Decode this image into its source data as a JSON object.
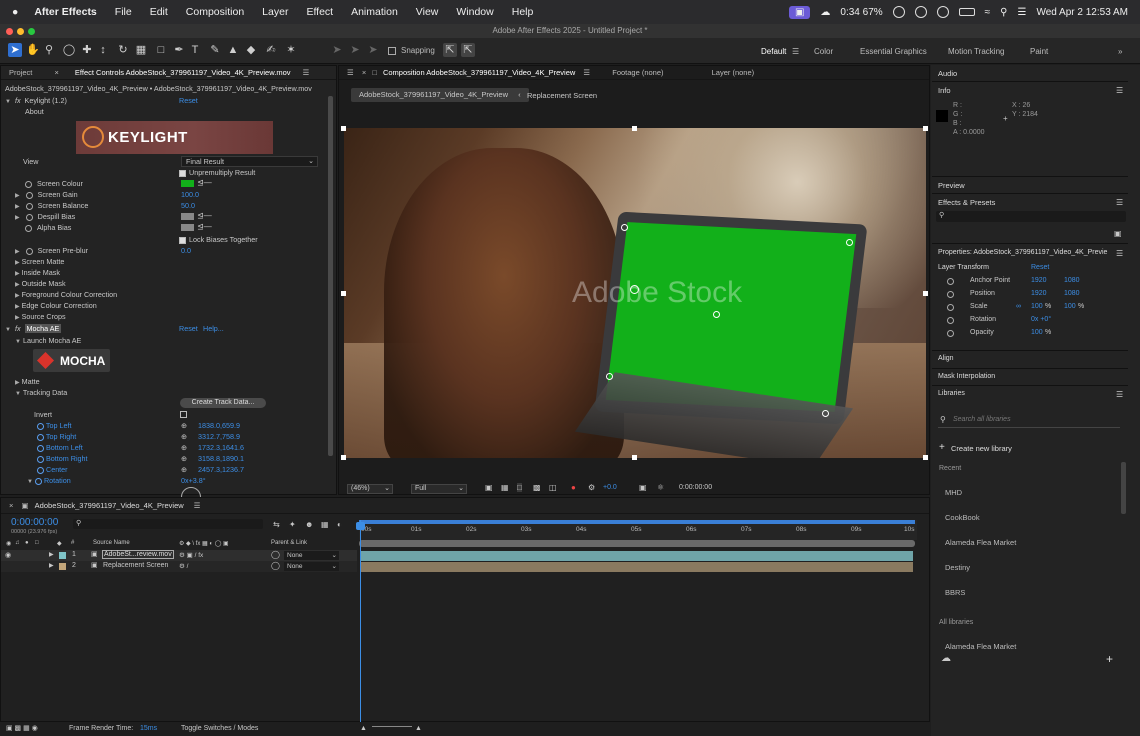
{
  "menubar": {
    "apple": "",
    "app": "After Effects",
    "items": [
      "File",
      "Edit",
      "Composition",
      "Layer",
      "Effect",
      "Animation",
      "View",
      "Window",
      "Help"
    ],
    "battery_status": "0:34 67%",
    "datetime": "Wed Apr 2  12:53 AM"
  },
  "window": {
    "title": "Adobe After Effects 2025 - Untitled Project *"
  },
  "toolbar": {
    "snapping": "Snapping",
    "workspaces": [
      "Default",
      "Color",
      "Essential Graphics",
      "Motion Tracking",
      "Paint"
    ]
  },
  "left_panel": {
    "tab_project": "Project",
    "tab_effect": "Effect Controls AdobeStock_379961197_Video_4K_Preview.mov",
    "breadcrumb": "AdobeStock_379961197_Video_4K_Preview • AdobeStock_379961197_Video_4K_Preview.mov",
    "keylight": {
      "name": "Keylight (1.2)",
      "reset": "Reset",
      "about": "About",
      "logo": "KEYLIGHT",
      "view_label": "View",
      "view_value": "Final Result",
      "unpremultiply": "Unpremultiply Result",
      "screen_colour": "Screen Colour",
      "screen_gain": "Screen Gain",
      "screen_gain_val": "100.0",
      "screen_balance": "Screen Balance",
      "screen_balance_val": "50.0",
      "despill_bias": "Despill Bias",
      "alpha_bias": "Alpha Bias",
      "lock_biases": "Lock Biases Together",
      "screen_preblur": "Screen Pre-blur",
      "screen_preblur_val": "0.0",
      "screen_matte": "Screen Matte",
      "inside_mask": "Inside Mask",
      "outside_mask": "Outside Mask",
      "fg_colour": "Foreground Colour Correction",
      "edge_colour": "Edge Colour Correction",
      "source_crops": "Source Crops"
    },
    "mocha": {
      "name": "Mocha AE",
      "reset": "Reset",
      "help": "Help...",
      "launch": "Launch Mocha AE",
      "logo": "MOCHA",
      "matte": "Matte",
      "tracking_data": "Tracking Data",
      "create_track": "Create Track Data...",
      "invert": "Invert",
      "top_left": "Top Left",
      "top_left_val": "1838.0,659.9",
      "top_right": "Top Right",
      "top_right_val": "3312.7,758.9",
      "bottom_left": "Bottom Left",
      "bottom_left_val": "1732.3,1641.6",
      "bottom_right": "Bottom Right",
      "bottom_right_val": "3158.8,1890.1",
      "center": "Center",
      "center_val": "2457.3,1236.7",
      "rotation": "Rotation",
      "rotation_val": "0x+3.8°"
    }
  },
  "comp_panel": {
    "tab_comp": "Composition AdobeStock_379961197_Video_4K_Preview",
    "tab_footage": "Footage (none)",
    "tab_layer": "Layer (none)",
    "crumb_active": "AdobeStock_379961197_Video_4K_Preview",
    "crumb_next": "Replacement Screen",
    "watermark": "Adobe Stock",
    "zoom": "(46%)",
    "resolution": "Full",
    "exposure": "+0.0",
    "timecode": "0:00:00:00"
  },
  "timeline": {
    "tab": "AdobeStock_379961197_Video_4K_Preview",
    "timecode": "0:00:00:00",
    "fps": "00000 (23.976 fps)",
    "col_num": "#",
    "col_source": "Source Name",
    "col_parent": "Parent & Link",
    "rulers": [
      "00s",
      "01s",
      "02s",
      "03s",
      "04s",
      "05s",
      "06s",
      "07s",
      "08s",
      "09s",
      "10s"
    ],
    "layers": [
      {
        "num": "1",
        "name": "AdobeSt...review.mov",
        "parent": "None"
      },
      {
        "num": "2",
        "name": "Replacement Screen",
        "parent": "None"
      }
    ],
    "footer_render": "Frame Render Time:",
    "footer_render_val": "15ms",
    "footer_toggle": "Toggle Switches / Modes"
  },
  "right_panel": {
    "audio": "Audio",
    "info": "Info",
    "r": "R :",
    "g": "G :",
    "b": "B :",
    "a": "A : 0.0000",
    "x": "X : 26",
    "y": "Y : 2184",
    "preview": "Preview",
    "effects_presets": "Effects & Presets",
    "properties": "Properties: AdobeStock_379961197_Video_4K_Previe",
    "layer_transform": "Layer Transform",
    "reset": "Reset",
    "anchor": "Anchor Point",
    "anchor_x": "1920",
    "anchor_y": "1080",
    "position": "Position",
    "position_x": "1920",
    "position_y": "1080",
    "scale": "Scale",
    "scale_x": "100",
    "scale_y": "100",
    "rotation": "Rotation",
    "rotation_val": "0x +0°",
    "opacity": "Opacity",
    "opacity_val": "100",
    "percent": "%",
    "align": "Align",
    "mask_interp": "Mask Interpolation",
    "libraries": "Libraries",
    "search_placeholder": "Search all libraries",
    "create_library": "Create new library",
    "recent": "Recent",
    "recent_items": [
      "MHD",
      "CookBook",
      "Alameda Flea Market",
      "Destiny",
      "BBRS"
    ],
    "all_libraries": "All libraries",
    "all_items": [
      "Alameda Flea Market"
    ]
  },
  "colors": {
    "accent": "#3c8ee6",
    "green_screen": "#12b01a",
    "menubar": "#2b2b2d"
  }
}
